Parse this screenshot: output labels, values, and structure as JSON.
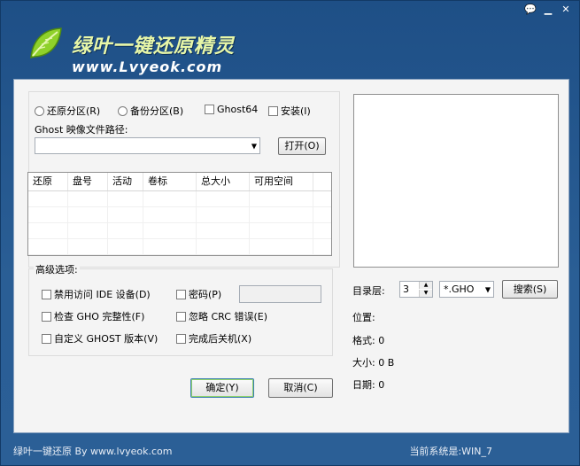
{
  "app": {
    "title": "绿叶一键还原精灵",
    "url": "www.Lvyeok.com"
  },
  "mode": {
    "restore": "还原分区(R)",
    "backup": "备份分区(B)",
    "ghost64": "Ghost64",
    "install": "安装(I)"
  },
  "path": {
    "label": "Ghost 映像文件路径:",
    "value": "",
    "open_button": "打开(O)"
  },
  "table": {
    "columns": [
      "还原",
      "盘号",
      "活动",
      "卷标",
      "总大小",
      "可用空间"
    ],
    "rows": [
      [],
      [],
      [],
      []
    ]
  },
  "advanced": {
    "title": "高级选项:",
    "disable_ide": "禁用访问 IDE 设备(D)",
    "password": "密码(P)",
    "check_gho": "检查 GHO 完整性(F)",
    "ignore_crc": "忽略 CRC 错误(E)",
    "custom_ghost": "自定义 GHOST 版本(V)",
    "shutdown": "完成后关机(X)"
  },
  "search": {
    "dir_level_label": "目录层:",
    "dir_level": "3",
    "ext": "*.GHO",
    "search_button": "搜索(S)"
  },
  "info": {
    "location": "位置:",
    "format": "格式: 0",
    "size": "大小: 0 B",
    "date": "日期: 0"
  },
  "actions": {
    "ok": "确定(Y)",
    "cancel": "取消(C)"
  },
  "status": {
    "left": "绿叶一键还原 By www.lvyeok.com",
    "right": "当前系统是:WIN_7"
  }
}
